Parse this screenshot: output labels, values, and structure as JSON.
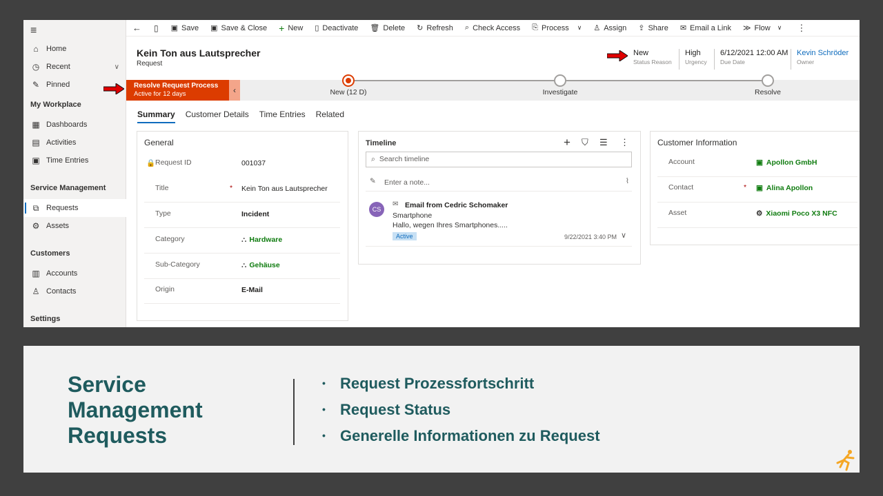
{
  "sidebar": {
    "items": [
      {
        "label": "Home",
        "icon": "home-icon"
      },
      {
        "label": "Recent",
        "icon": "clock-icon"
      },
      {
        "label": "Pinned",
        "icon": "pin-icon"
      }
    ],
    "my_workplace": {
      "header": "My Workplace",
      "items": [
        {
          "label": "Dashboards",
          "icon": "dashboard-icon"
        },
        {
          "label": "Activities",
          "icon": "clipboard-icon"
        },
        {
          "label": "Time Entries",
          "icon": "calendar-icon"
        }
      ]
    },
    "service_management": {
      "header": "Service Management",
      "items": [
        {
          "label": "Requests",
          "icon": "requests-icon"
        },
        {
          "label": "Assets",
          "icon": "gear-icon"
        }
      ]
    },
    "customers": {
      "header": "Customers",
      "items": [
        {
          "label": "Accounts",
          "icon": "building-icon"
        },
        {
          "label": "Contacts",
          "icon": "person-icon"
        }
      ]
    },
    "settings_header": "Settings"
  },
  "toolbar": {
    "save": "Save",
    "save_close": "Save & Close",
    "new": "New",
    "deactivate": "Deactivate",
    "delete": "Delete",
    "refresh": "Refresh",
    "check_access": "Check Access",
    "process": "Process",
    "assign": "Assign",
    "share": "Share",
    "email_link": "Email a Link",
    "flow": "Flow"
  },
  "record": {
    "title": "Kein Ton aus Lautsprecher",
    "entity": "Request",
    "status_reason": {
      "value": "New",
      "label": "Status Reason"
    },
    "urgency": {
      "value": "High",
      "label": "Urgency"
    },
    "due_date": {
      "value": "6/12/2021 12:00 AM",
      "label": "Due Date"
    },
    "owner": {
      "value": "Kevin Schröder",
      "label": "Owner"
    }
  },
  "bpf": {
    "active_title": "Resolve Request Process",
    "active_sub": "Active for 12 days",
    "stages": [
      {
        "label": "New  (12 D)",
        "current": true
      },
      {
        "label": "Investigate",
        "current": false
      },
      {
        "label": "Resolve",
        "current": false
      }
    ]
  },
  "tabs": [
    "Summary",
    "Customer Details",
    "Time Entries",
    "Related"
  ],
  "general": {
    "title": "General",
    "fields": [
      {
        "label": "Request ID",
        "value": "001037"
      },
      {
        "label": "Title",
        "value": "Kein Ton aus Lautsprecher"
      },
      {
        "label": "Type",
        "value": "Incident"
      },
      {
        "label": "Category",
        "value": "Hardware"
      },
      {
        "label": "Sub-Category",
        "value": "Gehäuse"
      },
      {
        "label": "Origin",
        "value": "E-Mail"
      }
    ]
  },
  "timeline": {
    "title": "Timeline",
    "search_placeholder": "Search timeline",
    "note_placeholder": "Enter a note...",
    "entry": {
      "initials": "CS",
      "heading": "Email from Cedric Schomaker",
      "subject": "Smartphone",
      "preview": "Hallo, wegen Ihres Smartphones.....",
      "badge": "Active",
      "timestamp": "9/22/2021 3:40 PM"
    }
  },
  "customer_info": {
    "title": "Customer Information",
    "fields": [
      {
        "label": "Account",
        "value": "Apollon GmbH"
      },
      {
        "label": "Contact",
        "value": "Alina Apollon"
      },
      {
        "label": "Asset",
        "value": "Xiaomi Poco X3 NFC"
      }
    ]
  },
  "slide": {
    "title_lines": [
      "Service",
      "Management",
      "Requests"
    ],
    "bullets": [
      "Request Prozessfortschritt",
      "Request Status",
      "Generelle Informationen zu Request"
    ]
  },
  "colors": {
    "accent_orange": "#dc3c00",
    "link_green": "#107c10",
    "slide_teal": "#1f5b5e",
    "arrow_red": "#e00000",
    "logo_orange": "#f5a623"
  }
}
